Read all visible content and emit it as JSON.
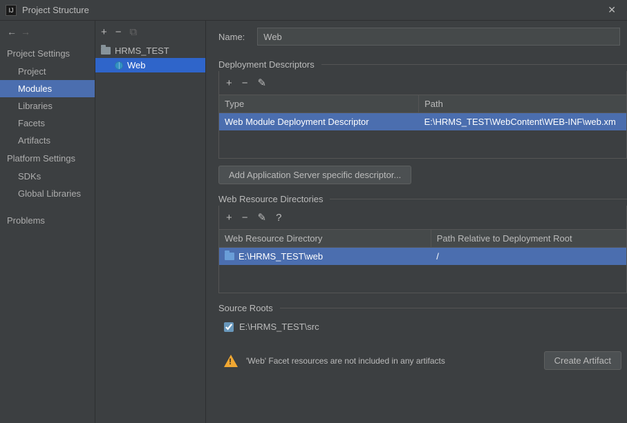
{
  "window": {
    "title": "Project Structure"
  },
  "nav": {
    "section1": "Project Settings",
    "items1": [
      "Project",
      "Modules",
      "Libraries",
      "Facets",
      "Artifacts"
    ],
    "section2": "Platform Settings",
    "items2": [
      "SDKs",
      "Global Libraries"
    ],
    "problems": "Problems"
  },
  "tree": {
    "module": "HRMS_TEST",
    "facet": "Web"
  },
  "form": {
    "name_label": "Name:",
    "name_value": "Web"
  },
  "deploy": {
    "title": "Deployment Descriptors",
    "col_type": "Type",
    "col_path": "Path",
    "row_type": "Web Module Deployment Descriptor",
    "row_path": "E:\\HRMS_TEST\\WebContent\\WEB-INF\\web.xm",
    "add_btn": "Add Application Server specific descriptor..."
  },
  "webres": {
    "title": "Web Resource Directories",
    "col_dir": "Web Resource Directory",
    "col_rel": "Path Relative to Deployment Root",
    "row_dir": "E:\\HRMS_TEST\\web",
    "row_rel": "/"
  },
  "src": {
    "title": "Source Roots",
    "item": "E:\\HRMS_TEST\\src"
  },
  "warning": {
    "msg": "'Web' Facet resources are not included in any artifacts",
    "btn": "Create Artifact"
  }
}
